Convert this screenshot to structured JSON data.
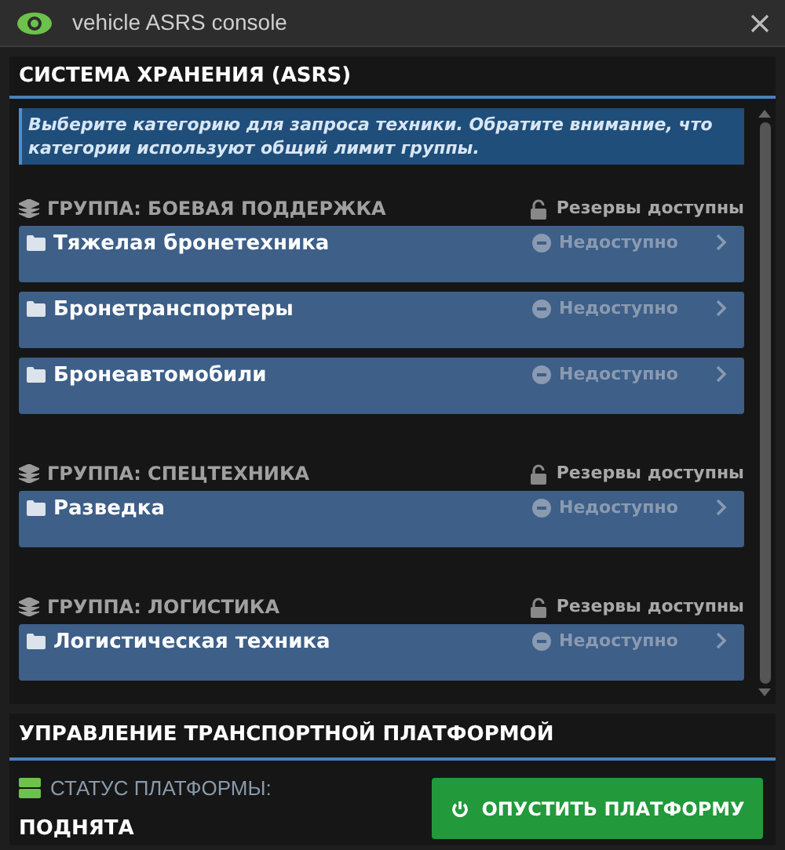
{
  "window": {
    "title": "vehicle ASRS console"
  },
  "storage": {
    "title": "СИСТЕМА ХРАНЕНИЯ (ASRS)",
    "notice": "Выберите категорию для запроса техники. Обратите внимание, что категории используют общий лимит группы.",
    "groups": [
      {
        "title": "ГРУППА: БОЕВАЯ ПОДДЕРЖКА",
        "reserve": "Резервы доступны",
        "locked": false,
        "categories": [
          {
            "name": "Тяжелая бронетехника",
            "status": "Недоступно",
            "available": false
          },
          {
            "name": "Бронетранспортеры",
            "status": "Недоступно",
            "available": false
          },
          {
            "name": "Бронеавтомобили",
            "status": "Недоступно",
            "available": false
          }
        ]
      },
      {
        "title": "ГРУППА: СПЕЦТЕХНИКА",
        "reserve": "Резервы доступны",
        "locked": false,
        "categories": [
          {
            "name": "Разведка",
            "status": "Недоступно",
            "available": false
          }
        ]
      },
      {
        "title": "ГРУППА: ЛОГИСТИКА",
        "reserve": "Резервы доступны",
        "locked": false,
        "categories": [
          {
            "name": "Логистическая техника",
            "status": "Недоступно",
            "available": false
          }
        ]
      }
    ]
  },
  "platform": {
    "title": "УПРАВЛЕНИЕ ТРАНСПОРТНОЙ ПЛАТФОРМОЙ",
    "status_label": "СТАТУС ПЛАТФОРМЫ:",
    "status_value": "ПОДНЯТА",
    "button": "ОПУСТИТЬ ПЛАТФОРМУ"
  }
}
